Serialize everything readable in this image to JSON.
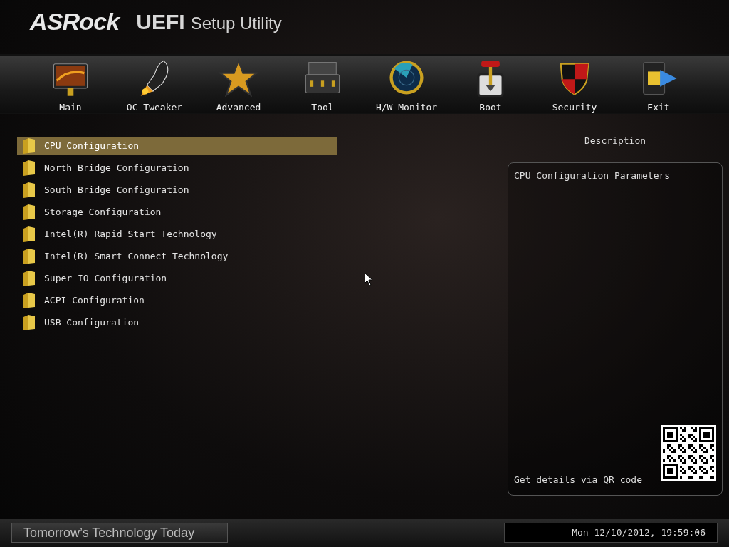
{
  "header": {
    "brand": "ASRock",
    "product": "UEFI",
    "subtitle": "Setup Utility"
  },
  "tabs": [
    {
      "label": "Main"
    },
    {
      "label": "OC Tweaker"
    },
    {
      "label": "Advanced"
    },
    {
      "label": "Tool"
    },
    {
      "label": "H/W Monitor"
    },
    {
      "label": "Boot"
    },
    {
      "label": "Security"
    },
    {
      "label": "Exit"
    }
  ],
  "menu": [
    {
      "label": "CPU Configuration",
      "selected": true
    },
    {
      "label": "North Bridge Configuration",
      "selected": false
    },
    {
      "label": "South Bridge Configuration",
      "selected": false
    },
    {
      "label": "Storage Configuration",
      "selected": false
    },
    {
      "label": "Intel(R) Rapid Start Technology",
      "selected": false
    },
    {
      "label": "Intel(R) Smart Connect Technology",
      "selected": false
    },
    {
      "label": "Super IO Configuration",
      "selected": false
    },
    {
      "label": "ACPI Configuration",
      "selected": false
    },
    {
      "label": "USB Configuration",
      "selected": false
    }
  ],
  "description": {
    "heading": "Description",
    "text": "CPU Configuration Parameters",
    "qr_hint": "Get details via QR code"
  },
  "footer": {
    "slogan": "Tomorrow’s Technology Today",
    "datetime": "Mon 12/10/2012, 19:59:06"
  }
}
